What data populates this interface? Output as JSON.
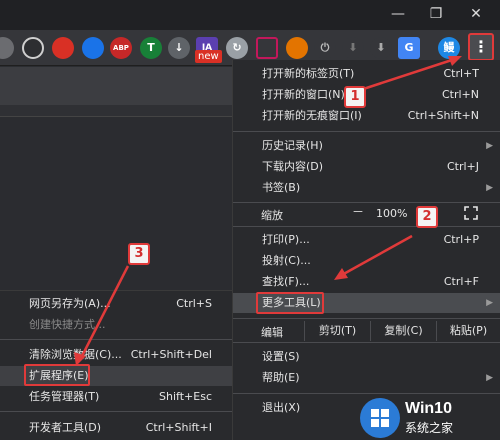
{
  "window_controls": {
    "minimize": "—",
    "restore": "❐",
    "close": "✕"
  },
  "toolbar": {
    "badge_new": "new",
    "avatar_text": "鳗",
    "menu_icon": "⋮",
    "extensions": [
      "ghost-icon",
      "hand-icon",
      "key-icon",
      "abp-icon",
      "t-icon",
      "download-icon",
      "ia-icon",
      "refresh-icon",
      "link-icon",
      "color-icon",
      "power-icon",
      "arrow-down-icon",
      "save-icon",
      "translate-icon"
    ]
  },
  "menu": {
    "items": [
      {
        "label": "打开新的标签页(T)",
        "shortcut": "Ctrl+T"
      },
      {
        "label": "打开新的窗口(N)",
        "shortcut": "Ctrl+N"
      },
      {
        "label": "打开新的无痕窗口(I)",
        "shortcut": "Ctrl+Shift+N"
      },
      {
        "label": "历史记录(H)",
        "shortcut": ""
      },
      {
        "label": "下载内容(D)",
        "shortcut": "Ctrl+J"
      },
      {
        "label": "书签(B)",
        "shortcut": ""
      },
      {
        "label": "打印(P)...",
        "shortcut": "Ctrl+P"
      },
      {
        "label": "投射(C)...",
        "shortcut": ""
      },
      {
        "label": "查找(F)...",
        "shortcut": "Ctrl+F"
      },
      {
        "label": "更多工具(L)",
        "shortcut": ""
      },
      {
        "label": "设置(S)",
        "shortcut": ""
      },
      {
        "label": "帮助(E)",
        "shortcut": ""
      },
      {
        "label": "退出(X)",
        "shortcut": ""
      }
    ],
    "zoom": {
      "label": "缩放",
      "minus": "－",
      "value": "100%",
      "plus": "+"
    },
    "edit": {
      "label": "编辑",
      "cut": "剪切(T)",
      "copy": "复制(C)",
      "paste": "粘贴(P)"
    }
  },
  "submenu": {
    "items": [
      {
        "label": "网页另存为(A)...",
        "shortcut": "Ctrl+S"
      },
      {
        "label": "创建快捷方式...",
        "shortcut": ""
      },
      {
        "label": "清除浏览数据(C)...",
        "shortcut": "Ctrl+Shift+Del"
      },
      {
        "label": "扩展程序(E)",
        "shortcut": ""
      },
      {
        "label": "任务管理器(T)",
        "shortcut": "Shift+Esc"
      },
      {
        "label": "开发者工具(D)",
        "shortcut": "Ctrl+Shift+I"
      }
    ]
  },
  "markers": {
    "m1": "1",
    "m2": "2",
    "m3": "3"
  },
  "colors": {
    "highlight": "#e03a3a",
    "menu_bg": "#292a2d"
  },
  "watermark": {
    "title": "Win10",
    "subtitle": "系统之家"
  }
}
